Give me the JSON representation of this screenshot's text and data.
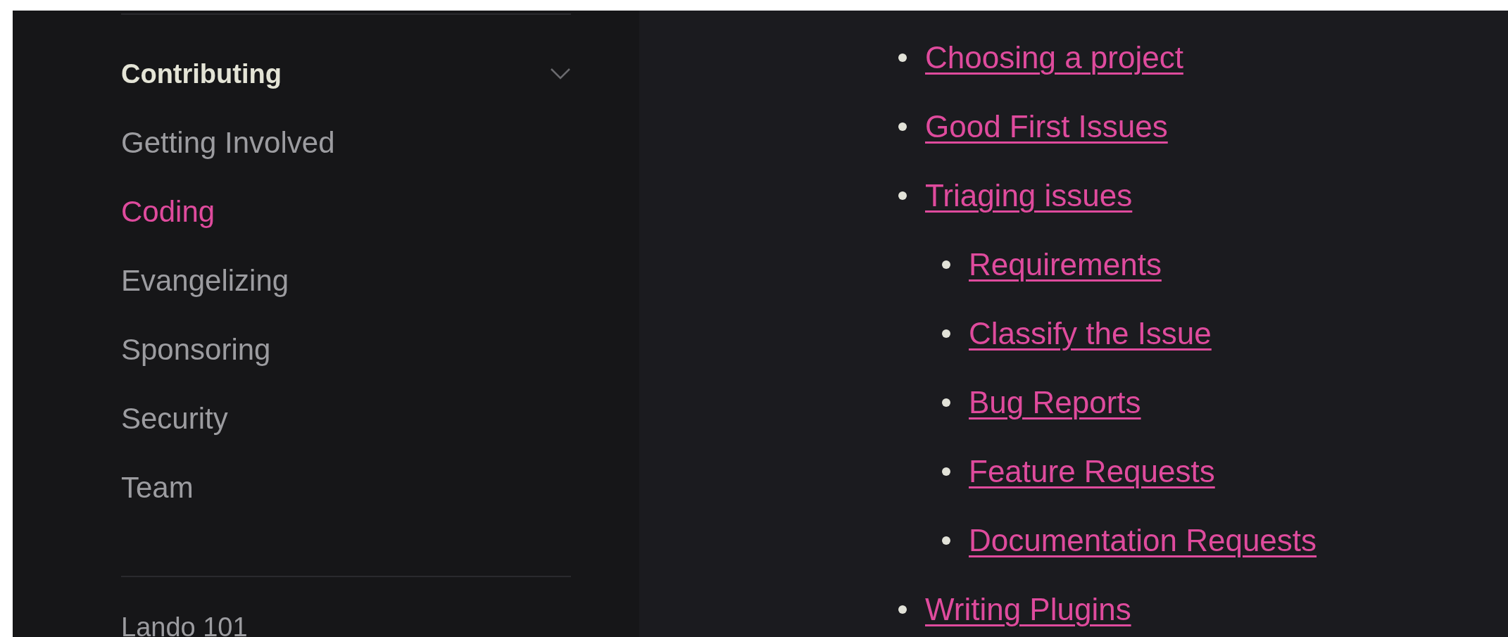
{
  "sidebar": {
    "section": {
      "title": "Contributing",
      "expanded": true,
      "items": [
        {
          "label": "Getting Involved",
          "selected": false
        },
        {
          "label": "Coding",
          "selected": true
        },
        {
          "label": "Evangelizing",
          "selected": false
        },
        {
          "label": "Sponsoring",
          "selected": false
        },
        {
          "label": "Security",
          "selected": false
        },
        {
          "label": "Team",
          "selected": false
        }
      ]
    },
    "next_section": "Lando 101"
  },
  "content": {
    "links": [
      {
        "label": "Choosing a project"
      },
      {
        "label": "Good First Issues"
      },
      {
        "label": "Triaging issues",
        "children": [
          {
            "label": "Requirements"
          },
          {
            "label": "Classify the Issue"
          },
          {
            "label": "Bug Reports"
          },
          {
            "label": "Feature Requests"
          },
          {
            "label": "Documentation Requests"
          }
        ]
      },
      {
        "label": "Writing Plugins"
      }
    ]
  }
}
